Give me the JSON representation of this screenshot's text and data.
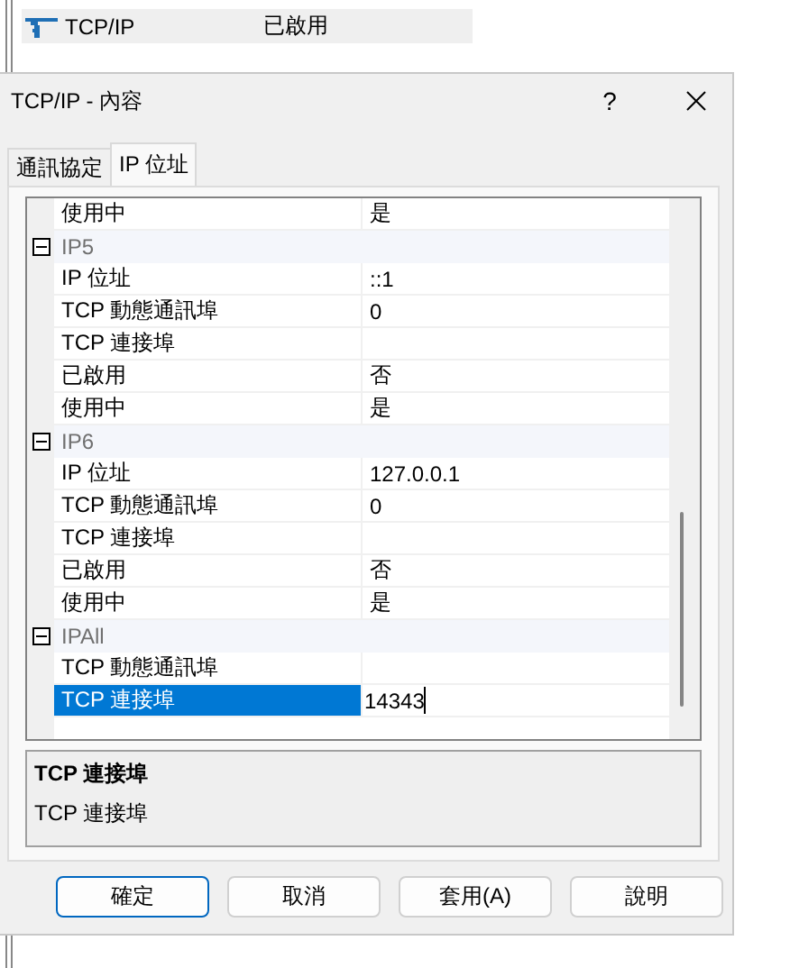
{
  "background_window": {
    "rows": [
      {
        "name": "TCP/IP",
        "status": "已啟用",
        "selected": true
      }
    ]
  },
  "dialog": {
    "title": "TCP/IP - 內容",
    "help_button": "?",
    "tabs": [
      {
        "label": "通訊協定",
        "selected": false
      },
      {
        "label": "IP 位址",
        "selected": true
      }
    ],
    "grid": {
      "rows": [
        {
          "kind": "property",
          "name": "使用中",
          "value": "是",
          "selected": false
        },
        {
          "kind": "category",
          "name": "IP5",
          "expanded": true
        },
        {
          "kind": "property",
          "name": "IP 位址",
          "value": "::1",
          "selected": false
        },
        {
          "kind": "property",
          "name": "TCP 動態通訊埠",
          "value": "0",
          "selected": false
        },
        {
          "kind": "property",
          "name": "TCP 連接埠",
          "value": "",
          "selected": false
        },
        {
          "kind": "property",
          "name": "已啟用",
          "value": "否",
          "selected": false
        },
        {
          "kind": "property",
          "name": "使用中",
          "value": "是",
          "selected": false
        },
        {
          "kind": "category",
          "name": "IP6",
          "expanded": true
        },
        {
          "kind": "property",
          "name": "IP 位址",
          "value": "127.0.0.1",
          "selected": false
        },
        {
          "kind": "property",
          "name": "TCP 動態通訊埠",
          "value": "0",
          "selected": false
        },
        {
          "kind": "property",
          "name": "TCP 連接埠",
          "value": "",
          "selected": false
        },
        {
          "kind": "property",
          "name": "已啟用",
          "value": "否",
          "selected": false
        },
        {
          "kind": "property",
          "name": "使用中",
          "value": "是",
          "selected": false
        },
        {
          "kind": "category",
          "name": "IPAll",
          "expanded": true
        },
        {
          "kind": "property",
          "name": "TCP 動態通訊埠",
          "value": "",
          "selected": false
        },
        {
          "kind": "property",
          "name": "TCP 連接埠",
          "value": "14343",
          "selected": true
        }
      ]
    },
    "description": {
      "title": "TCP 連接埠",
      "text": "TCP 連接埠"
    },
    "buttons": [
      {
        "label": "確定",
        "default": true
      },
      {
        "label": "取消",
        "default": false
      },
      {
        "label": "套用(A)",
        "default": false
      },
      {
        "label": "說明",
        "default": false
      }
    ]
  }
}
